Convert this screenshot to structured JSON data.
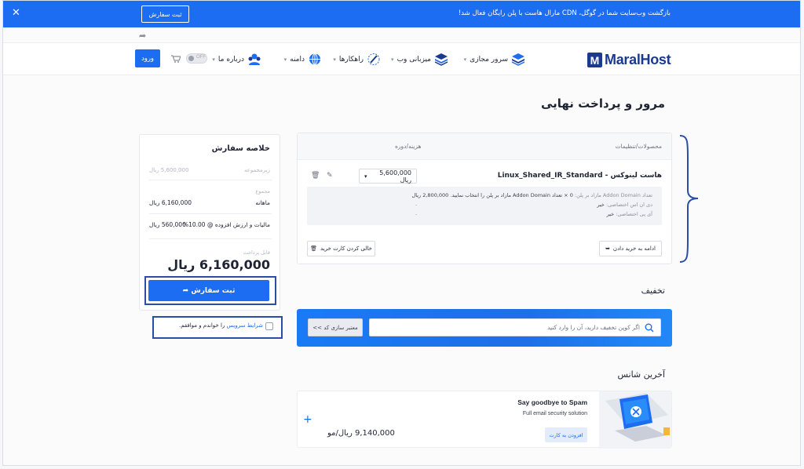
{
  "promo": {
    "text": "بازگشت وب‌سایت شما در گوگل، CDN مارال هاست با پلن رایگان فعال شد!",
    "button": "ثبت سفارش"
  },
  "header": {
    "logo": "MaralHost",
    "nav": [
      "سرور مجازی",
      "میزبانی وب",
      "راهکارها",
      "دامنه",
      "درباره ما"
    ],
    "toggle_text": "OFF",
    "login": "ورود"
  },
  "page": {
    "title": "مرور و پرداخت نهایی"
  },
  "products": {
    "col_product": "محصولات/تنظیمات",
    "col_price": "هزینه/دوره",
    "name": "هاست لینوکس - Linux_Shared_IR_Standard",
    "price_select": "5,600,000 ریال",
    "details": [
      {
        "label": "تعداد Addon Domain مازاد بر پلن: ",
        "value": "0 × تعداد Addon Domain مازاد بر پلن را انتخاب نمایید. 2,800,000 ریال"
      },
      {
        "label": "دی ان اس اختصاصی: ",
        "value": "خیر"
      },
      {
        "label": "آی پی اختصاصی: ",
        "value": "خیر"
      }
    ],
    "continue_btn": "ادامه به خرید دادن",
    "empty_btn": "خالی کردن کارت خرید"
  },
  "summary": {
    "title": "خلاصه سفارش",
    "subtotal_label": "زیرمجموعه",
    "subtotal_value": "5,600,000 ریال",
    "totals_label": "مجموع",
    "period_label": "ماهانه",
    "period_value": "6,160,000 ریال",
    "tax_label": "مالیات و ارزش افزوده @ 10.00%",
    "tax_value": "560,000 ریال",
    "payable_label": "قابل پرداخت",
    "total": "6,160,000 ریال",
    "order_btn": "ثبت سفارش",
    "agree_text": "را خواندم و موافقم.",
    "agree_link": "شرایط سرویس"
  },
  "discount": {
    "title": "تخفیف",
    "placeholder": "اگر کوپن تخفیف دارید، آن را وارد کنید",
    "validate_btn": "معتبر سازی کد >>"
  },
  "last_chance": {
    "title": "آخرین شانس",
    "offer_title": "Say goodbye to Spam",
    "offer_sub": "Full email security solution",
    "add_btn": "افزودن به کارت",
    "price": "9,140,000 ریال/مو"
  },
  "colors": {
    "accent": "#1c6df2",
    "brand": "#1b3a8f",
    "highlight": "#2a4ea8"
  }
}
